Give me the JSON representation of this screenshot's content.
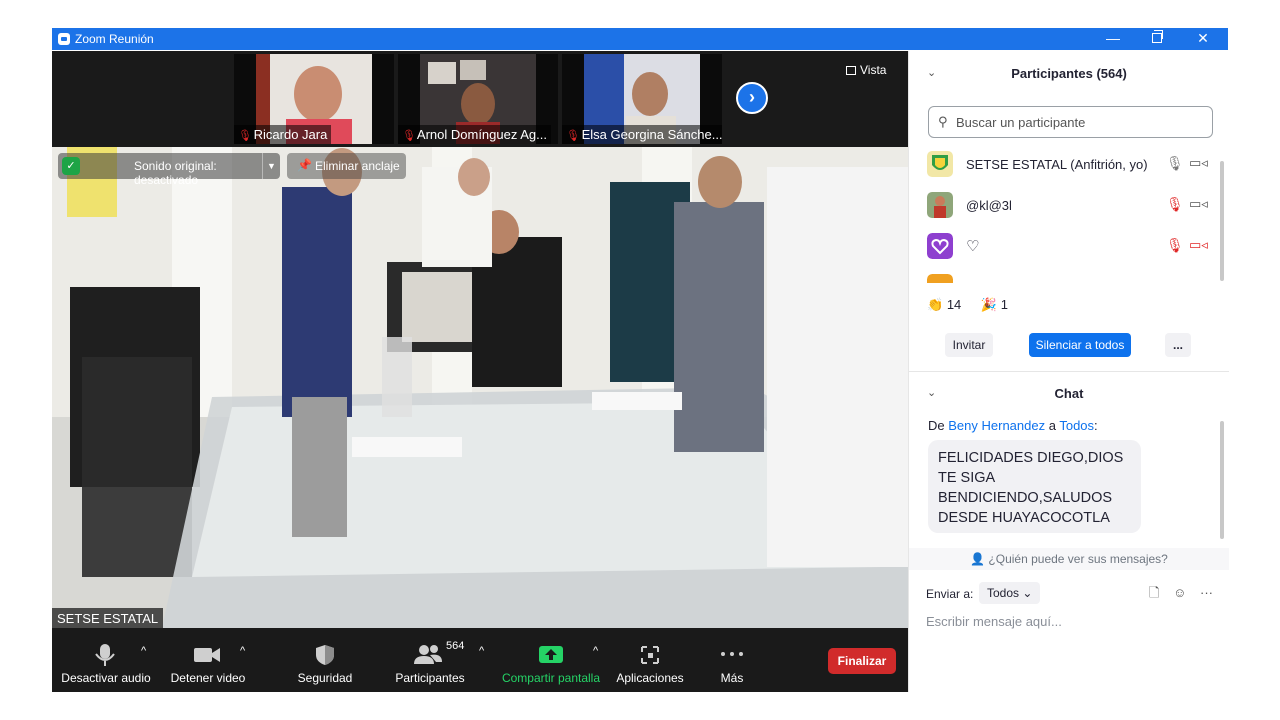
{
  "window": {
    "title": "Zoom Reunión"
  },
  "strip": {
    "thumbnails": [
      {
        "name": "Ricardo Jara"
      },
      {
        "name": "Arnol Domínguez Ag..."
      },
      {
        "name": "Elsa Georgina Sánche..."
      }
    ],
    "view_label": "Vista"
  },
  "main": {
    "sound_label": "Sonido original: desactivado",
    "unpin_label": "Eliminar anclaje",
    "speaker_name": "SETSE ESTATAL"
  },
  "toolbar": {
    "mute_label": "Desactivar audio",
    "video_label": "Detener video",
    "security_label": "Seguridad",
    "participants_label": "Participantes",
    "participants_count": "564",
    "share_label": "Compartir pantalla",
    "apps_label": "Aplicaciones",
    "more_label": "Más",
    "end_label": "Finalizar"
  },
  "participants": {
    "header": "Participantes (564)",
    "search_placeholder": "Buscar un participante",
    "list": [
      {
        "name": "SETSE ESTATAL (Anfitrión, yo)"
      },
      {
        "name": "@kl@3l"
      },
      {
        "name": "♡"
      }
    ],
    "reactions": {
      "clap": "14",
      "party": "1"
    },
    "invite_label": "Invitar",
    "mute_all_label": "Silenciar a todos",
    "more_label": "..."
  },
  "chat": {
    "header": "Chat",
    "from_prefix": "De",
    "sender": "Beny Hernandez",
    "to_word": "a",
    "recipient": "Todos",
    "message": "FELICIDADES DIEGO,DIOS TE SIGA BENDICIENDO,SALUDOS DESDE HUAYACOCOTLA",
    "who_can_see": "¿Quién puede ver sus mensajes?",
    "send_to_label": "Enviar a:",
    "send_to_value": "Todos",
    "input_placeholder": "Escribir mensaje aquí..."
  },
  "colors": {
    "titlebar": "#1c73e8",
    "accent": "#0e72ed",
    "end_button": "#d12b2b",
    "share_green": "#25d366"
  }
}
